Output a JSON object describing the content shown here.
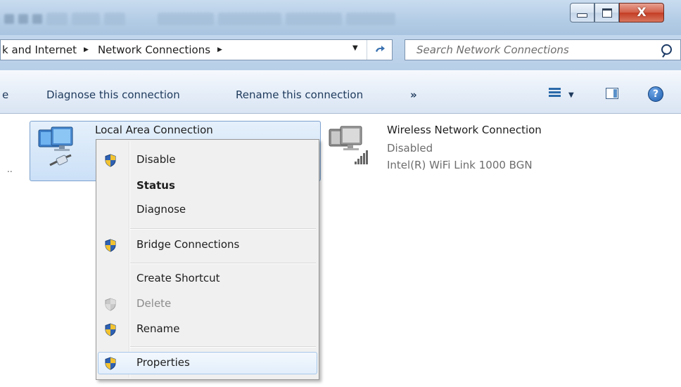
{
  "window": {
    "minimize_glyph": "minimize",
    "maximize_glyph": "maximize",
    "close_label": "X"
  },
  "address_bar": {
    "crumbs": [
      "k and Internet",
      "Network Connections"
    ],
    "search_placeholder": "Search Network Connections"
  },
  "command_bar": {
    "partial_label": "e",
    "diagnose_label": "Diagnose this connection",
    "rename_label": "Rename this connection",
    "more_label": "»",
    "help_label": "?"
  },
  "content": {
    "left_dots": "..",
    "lan": {
      "name": "Local Area Connection"
    },
    "wifi": {
      "name": "Wireless Network Connection",
      "status": "Disabled",
      "adapter": "Intel(R) WiFi Link 1000 BGN"
    }
  },
  "context_menu": {
    "items": [
      {
        "label": "Disable",
        "icon": "uac-shield-icon"
      },
      {
        "label": "Status",
        "bold": true
      },
      {
        "label": "Diagnose"
      },
      {
        "label": "Bridge Connections",
        "icon": "uac-shield-icon"
      },
      {
        "label": "Create Shortcut"
      },
      {
        "label": "Delete",
        "icon": "uac-shield-icon",
        "disabled": true
      },
      {
        "label": "Rename",
        "icon": "uac-shield-icon"
      },
      {
        "label": "Properties",
        "icon": "uac-shield-icon",
        "highlighted": true
      }
    ]
  },
  "colors": {
    "titlebar": "#b4cde6",
    "close_button": "#c43c23",
    "selection": "#cbe0f7",
    "menu_background": "#f0f0f0"
  }
}
